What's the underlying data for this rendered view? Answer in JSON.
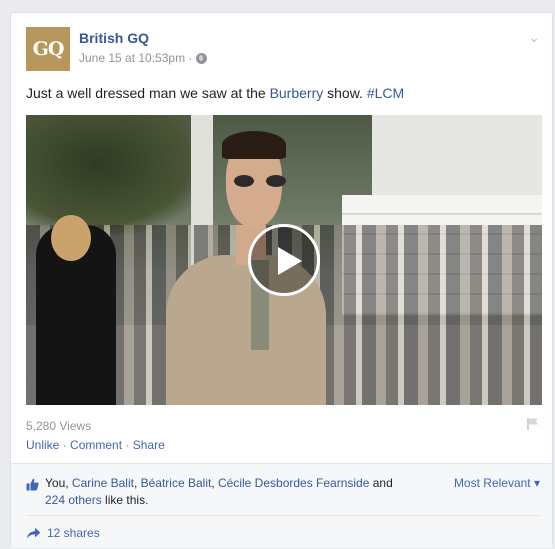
{
  "post": {
    "page_name": "British GQ",
    "avatar_text": "GQ",
    "timestamp": "June 15 at 10:53pm · ",
    "text_before": "Just a well dressed man we saw at the ",
    "link_text": "Burberry",
    "text_middle": " show. ",
    "hashtag": "#LCM"
  },
  "video": {
    "views": "5,280 Views"
  },
  "actions": {
    "unlike": "Unlike",
    "comment": "Comment",
    "share": "Share",
    "sep": " · "
  },
  "likes": {
    "you": "You, ",
    "names": [
      "Carine Balit",
      "Béatrice Balit",
      "Cécile Desbordes Fearnside"
    ],
    "comma": ", ",
    "and": " and",
    "others_link": "224 others",
    "suffix": " like this.",
    "sort_label": "Most Relevant ▾"
  },
  "shares": {
    "label": "12 shares"
  },
  "colors": {
    "link": "#365899",
    "accent": "#4267b2",
    "muted": "#90949c",
    "avatar_bg": "#b8975c"
  },
  "icons": [
    "globe-icon",
    "chevron-down-icon",
    "play-icon",
    "flag-icon",
    "thumbs-up-icon",
    "share-icon"
  ]
}
